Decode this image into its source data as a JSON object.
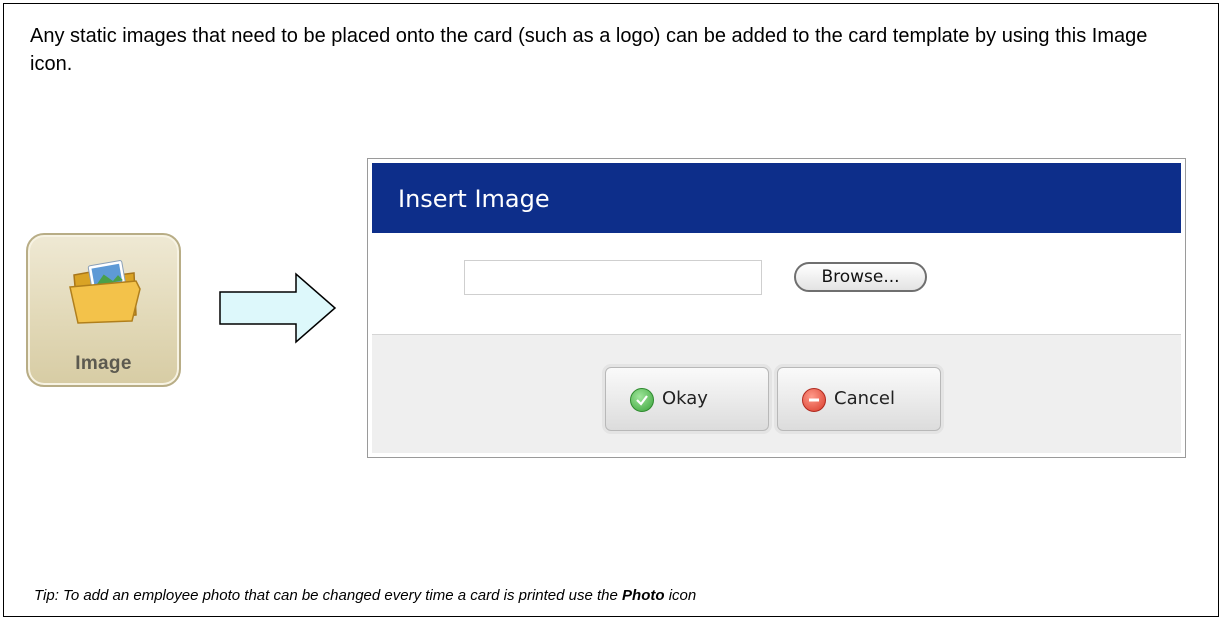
{
  "intro_text": "Any static images that need to be placed onto the card (such as a logo) can be added to the card template by using this Image icon.",
  "image_tile": {
    "label": "Image",
    "icon": "folder-image-icon"
  },
  "dialog": {
    "title": "Insert Image",
    "file_input_value": "",
    "browse_label": "Browse...",
    "okay_label": "Okay",
    "cancel_label": "Cancel",
    "title_color": "#0d2e8a"
  },
  "tip": {
    "prefix": "Tip:  To add an employee photo that can be changed every time a card is printed use the ",
    "emphasis": "Photo",
    "suffix": " icon"
  }
}
